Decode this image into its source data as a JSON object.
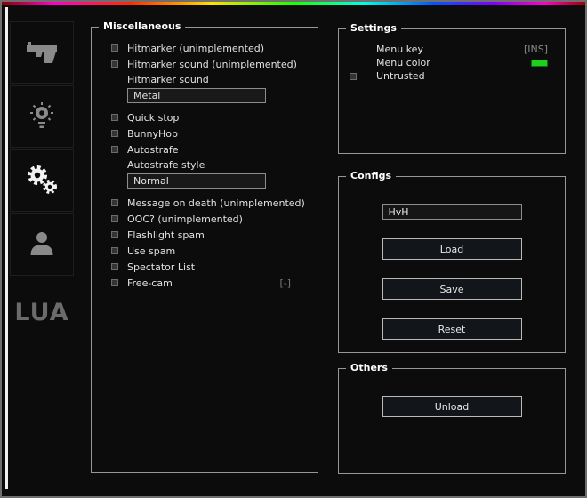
{
  "window": {
    "accent_gradient_css": "linear-gradient(90deg,#8a0000 0%,#ff00c8 9%,#ff2a00 22%,#ffe100 36%,#1aff00 50%,#00ffe1 62%,#0055ff 74%,#7a00ff 84%,#ff00c8 93%,#a00000 100%)"
  },
  "sidebar": {
    "lua_label": "LUA"
  },
  "misc": {
    "title": "Miscellaneous",
    "items": [
      {
        "type": "checkbox",
        "label": "Hitmarker (unimplemented)",
        "checked": false
      },
      {
        "type": "checkbox",
        "label": "Hitmarker sound (unimplemented)",
        "checked": false
      },
      {
        "type": "label",
        "label": "Hitmarker sound"
      },
      {
        "type": "dropdown",
        "value": "Metal"
      },
      {
        "type": "checkbox",
        "label": "Quick stop",
        "checked": false
      },
      {
        "type": "checkbox",
        "label": "BunnyHop",
        "checked": false
      },
      {
        "type": "checkbox",
        "label": "Autostrafe",
        "checked": false
      },
      {
        "type": "label",
        "label": "Autostrafe style"
      },
      {
        "type": "dropdown",
        "value": "Normal"
      },
      {
        "type": "checkbox",
        "label": "Message on death (unimplemented)",
        "checked": false
      },
      {
        "type": "checkbox",
        "label": "OOC? (unimplemented)",
        "checked": false
      },
      {
        "type": "checkbox",
        "label": "Flashlight spam",
        "checked": false
      },
      {
        "type": "checkbox",
        "label": "Use spam",
        "checked": false
      },
      {
        "type": "checkbox",
        "label": "Spectator List",
        "checked": false
      },
      {
        "type": "checkbox",
        "label": "Free-cam",
        "checked": false,
        "keybind": "[-]"
      }
    ]
  },
  "settings": {
    "title": "Settings",
    "menu_key_label": "Menu key",
    "menu_key_value": "[INS]",
    "menu_color_label": "Menu color",
    "menu_color_value": "#1dd11d",
    "untrusted_label": "Untrusted",
    "untrusted_checked": false
  },
  "configs": {
    "title": "Configs",
    "config_name_value": "HvH",
    "load_label": "Load",
    "save_label": "Save",
    "reset_label": "Reset"
  },
  "others": {
    "title": "Others",
    "unload_label": "Unload"
  }
}
